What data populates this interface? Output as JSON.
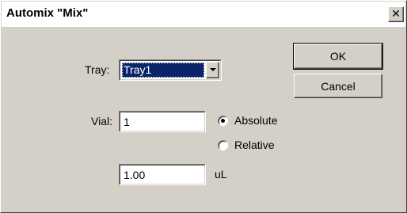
{
  "window": {
    "title": "Automix \"Mix\"",
    "close_glyph": "✕"
  },
  "form": {
    "tray_label": "Tray:",
    "tray_value": "Tray1",
    "vial_label": "Vial:",
    "vial_value": "1",
    "vial_mode_options": [
      {
        "label": "Absolute",
        "checked": true
      },
      {
        "label": "Relative",
        "checked": false
      }
    ],
    "volume_value": "1.00",
    "volume_unit": "uL"
  },
  "buttons": {
    "ok_label": "OK",
    "cancel_label": "Cancel"
  },
  "colors": {
    "dialog_bg": "#d4d0c8",
    "selection_bg": "#0a246a"
  }
}
